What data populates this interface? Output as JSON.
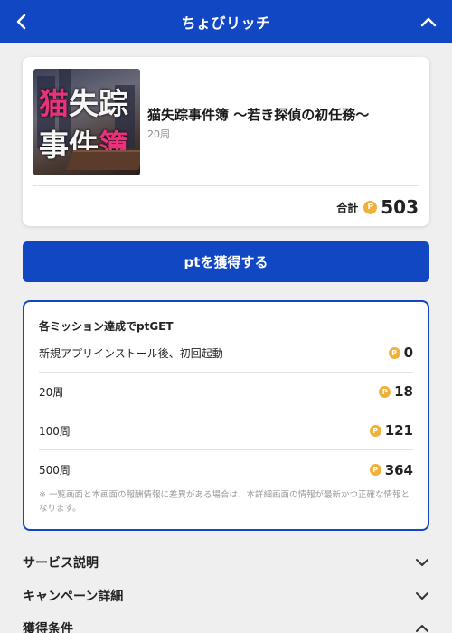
{
  "header": {
    "title": "ちょびリッチ",
    "back_icon": "chevron-left-icon",
    "collapse_icon": "chevron-up-icon"
  },
  "app": {
    "thumb_line1_a": "猫",
    "thumb_line1_b": "失踪",
    "thumb_line2_a": "事件",
    "thumb_line2_b": "簿",
    "title": "猫失踪事件簿 〜若き探偵の初任務〜",
    "subtitle": "20周",
    "total_label": "合計",
    "total_value": "503"
  },
  "coin_glyph": "P",
  "get_button": {
    "label": "ptを獲得する"
  },
  "missions": {
    "heading": "各ミッション達成でptGET",
    "rows": [
      {
        "label": "新規アプリインストール後、初回起動",
        "points": "0"
      },
      {
        "label": "20周",
        "points": "18"
      },
      {
        "label": "100周",
        "points": "121"
      },
      {
        "label": "500周",
        "points": "364"
      }
    ],
    "note": "※ 一覧画面と本画面の報酬情報に差異がある場合は、本詳細画面の情報が最新かつ正確な情報となります。"
  },
  "accordions": [
    {
      "label": "サービス説明",
      "icon": "chevron-down-icon"
    },
    {
      "label": "キャンペーン詳細",
      "icon": "chevron-down-icon"
    },
    {
      "label": "獲得条件",
      "icon": "chevron-up-icon"
    }
  ],
  "colors": {
    "brand_blue": "#1247c4",
    "coin_gold": "#f0b13a",
    "accent_pink": "#e8327c"
  }
}
